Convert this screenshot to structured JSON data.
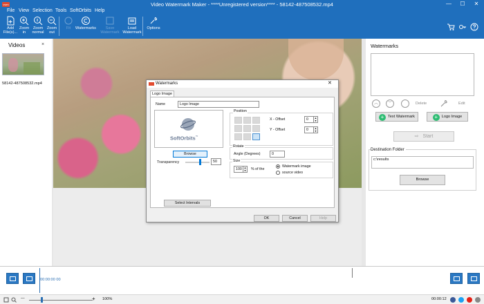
{
  "window": {
    "title": "Video Watermark Maker - ****Unregistered version**** - 58142-487508532.mp4",
    "app_icon_text": "vwm",
    "minimize": "—",
    "maximize": "☐",
    "close": "✕"
  },
  "menu": [
    "File",
    "View",
    "Selection",
    "Tools",
    "SoftOrbits",
    "Help"
  ],
  "ribbon": {
    "add_files": "Add\nFile(s)...",
    "zoom_in": "Zoom\nin",
    "zoom_normal": "Zoom\nnormal",
    "zoom_out": "Zoom\nout",
    "disabled_button": "Fit",
    "watermarks": "Watermarks",
    "save_watermark": "Save\nWatermark",
    "load_watermark": "Load\nWatermark",
    "options": "Options"
  },
  "videos_panel": {
    "title": "Videos",
    "close": "×",
    "items": [
      {
        "filename": "58142-487508532.mp4"
      }
    ]
  },
  "watermarks_panel": {
    "title": "Watermarks",
    "delete_label": "Delete",
    "edit_label": "Edit",
    "text_watermark_button": "Text Watermark",
    "logo_image_button": "Logo Image",
    "start_button": "Start",
    "destination_title": "Destination Folder",
    "destination_value": "c:\\results",
    "browse_button": "Browse"
  },
  "dialog": {
    "title": "Watermarks",
    "close": "✕",
    "tab": "Logo Image",
    "name_label": "Name",
    "name_value": "Logo Image",
    "logo_text": "SoftOrbits",
    "logo_tm": "™",
    "browse_button": "Browse",
    "transparency_label": "Transparency",
    "transparency_value": "50",
    "transparency_fraction": 0.6,
    "position_label": "Position",
    "x_offset_label": "X - Offset",
    "x_offset_value": "0",
    "y_offset_label": "Y - Offset",
    "y_offset_value": "0",
    "rotate_label": "Rotate",
    "angle_label": "Angle (Degrees)",
    "angle_value": "0",
    "size_label": "Size",
    "size_value": "100",
    "size_suffix": "% of the",
    "radio_watermark_image": "Watermark image",
    "radio_source_video": "source video",
    "select_intervals_button": "Select Intervals",
    "ok_button": "OK",
    "cancel_button": "Cancel",
    "help_button": "Help"
  },
  "timeline": {
    "current_time": "00:00:00 00"
  },
  "status": {
    "zoom_level": "100%",
    "duration": "00:00:12",
    "zoom_minus": "—",
    "zoom_plus": "+"
  },
  "colors": {
    "ribbon": "#1f6fbd",
    "accent_green": "#2ebd73",
    "timeline_blue": "#2a78c3"
  }
}
